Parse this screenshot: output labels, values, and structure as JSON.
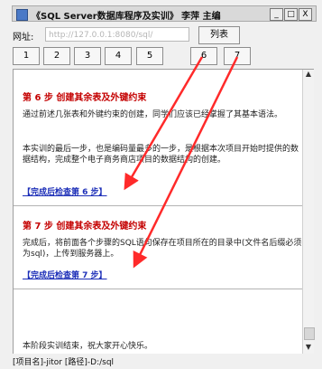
{
  "window": {
    "title": "《SQL Server数据库程序及实训》 李萍 主编",
    "buttons": {
      "minimize": "_",
      "maximize": "□",
      "close": "X"
    }
  },
  "urlbar": {
    "label": "网址:",
    "value": "http://127.0.0.1:8080/sql/",
    "list_button": "列表"
  },
  "steps": [
    "1",
    "2",
    "3",
    "4",
    "5",
    "6",
    "7"
  ],
  "content": {
    "step6": {
      "title": "第 6 步 创建其余表及外键约束",
      "para1": "通过前述几张表和外键约束的创建，同学们应该已经掌握了其基本语法。",
      "para2": "本实训的最后一步，也是编码量最多的一步，是根据本次项目开始时提供的数据结构，完成整个电子商务商店项目的数据结构的创建。",
      "link": "【完成后检查第 6 步】"
    },
    "step7": {
      "title": "第 7 步 创建其余表及外键约束",
      "para1": "完成后，将前面各个步骤的SQL语句保存在项目所在的目录中(文件名后缀必须为sql)，上传到服务器上。",
      "link": "【完成后检查第 7 步】"
    },
    "ending": "本阶段实训结束，祝大家开心快乐。"
  },
  "statusbar": {
    "text": "[项目名]-jitor [路径]-D:/sql"
  },
  "colors": {
    "annotation_arrow": "#ff2a2a"
  }
}
